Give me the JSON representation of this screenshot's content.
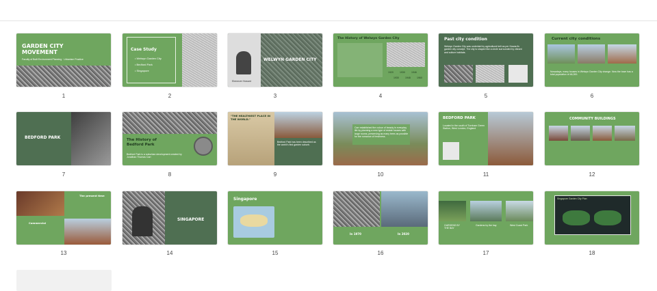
{
  "slides": [
    {
      "n": "1",
      "title": "GARDEN CITY MOVEMENT",
      "sub": "Faculty of Built Environment Planning · Urbanism Practice"
    },
    {
      "n": "2",
      "title": "Case Study",
      "bullets": [
        "• Welwyn Garden City",
        "• Bedford Park",
        "• Singapore"
      ]
    },
    {
      "n": "3",
      "title": "WELWYN GARDEN CITY",
      "caption": "Ebenezer Howard"
    },
    {
      "n": "4",
      "title": "The History of Welwyn Garden City",
      "years": [
        "1920",
        "1930",
        "1946",
        "1930",
        "1948",
        "1960"
      ]
    },
    {
      "n": "5",
      "title": "Past city condition",
      "body": "Welwyn Garden City was underlaid by agricultural belt as per Howard's garden city concept. The city is shaped like a circle surrounded by vibrant and culture habitats."
    },
    {
      "n": "6",
      "title": "Current city conditions",
      "body": "Nowadays, many houses in Welwyn Garden City change. Now the town has a total population of 46,000."
    },
    {
      "n": "7",
      "title": "BEDFORD PARK"
    },
    {
      "n": "8",
      "title": "The History of Bedford Park",
      "body": "Bedford Park is a suburban development created by Jonathan Thomas Carr"
    },
    {
      "n": "9",
      "title": "\"THE HEALTHIEST PLACE IN THE WORLD.\"",
      "body": "Bedford Park has been described as the world's first garden suburb."
    },
    {
      "n": "10",
      "body": "Carr established the colour of beauty in everyday life by planning a new type of estate houses with large rooms, preserving as many trees as possible for the romance of freshness."
    },
    {
      "n": "11",
      "title": "BEDFORD PARK",
      "body": "Located in the south of Turnham Green Station, West London, England"
    },
    {
      "n": "12",
      "title": "COMMUNITY BUILDINGS"
    },
    {
      "n": "13",
      "title": "The present time",
      "sub": "Commercial"
    },
    {
      "n": "14",
      "title": "SINGAPORE"
    },
    {
      "n": "15",
      "title": "Singapore"
    },
    {
      "n": "16",
      "left": "In 1970",
      "right": "In 2020"
    },
    {
      "n": "17",
      "labels": [
        "GARDENS BY THE BAY",
        "Gardens by the bay",
        "West Coast Park"
      ]
    },
    {
      "n": "18",
      "title": "Singapore Garden City Plan"
    }
  ]
}
